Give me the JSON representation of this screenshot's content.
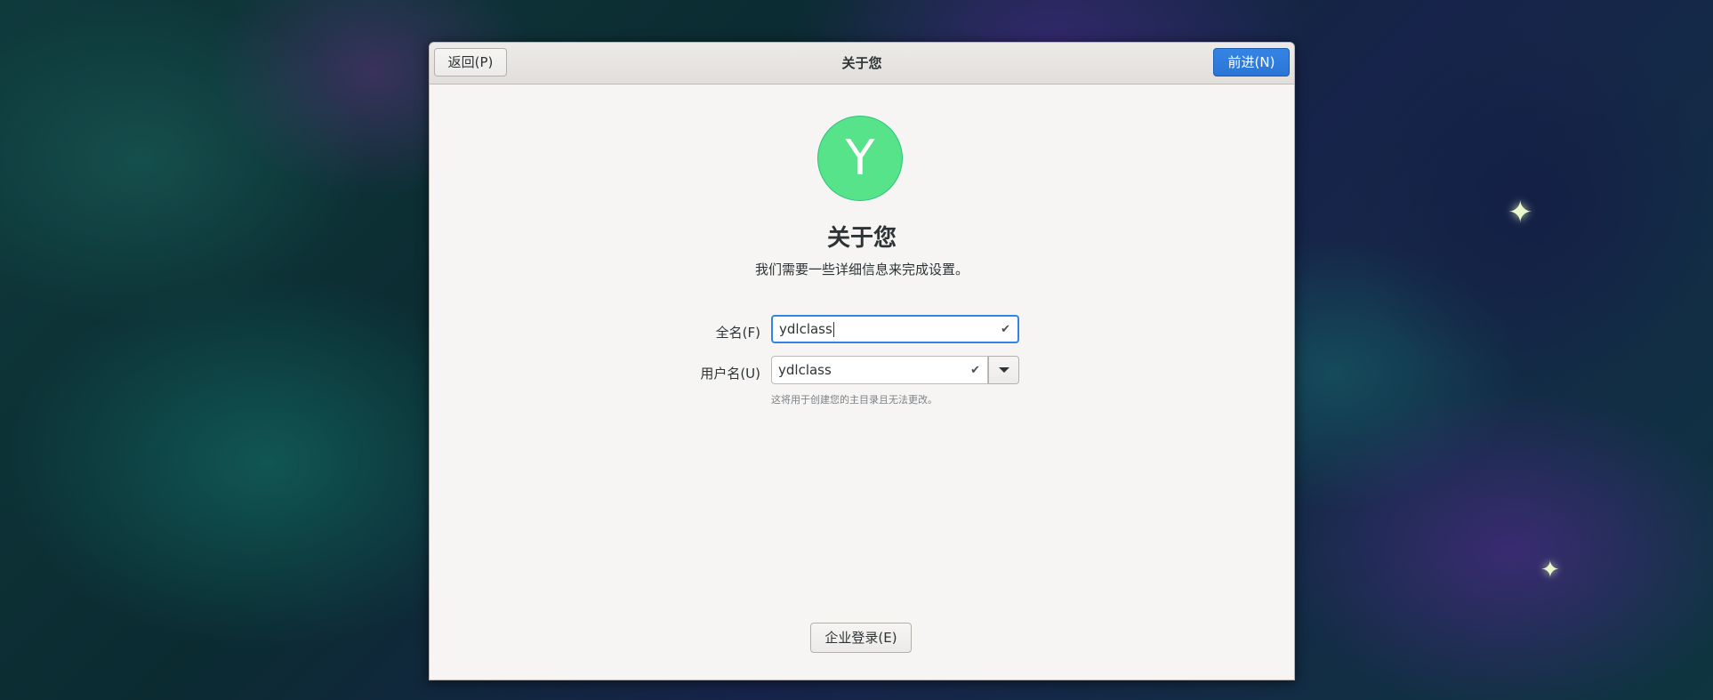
{
  "window": {
    "title": "关于您",
    "back_label": "返回(P)",
    "next_label": "前进(N)"
  },
  "avatar": {
    "letter": "Y",
    "color": "#57e389"
  },
  "page": {
    "heading": "关于您",
    "subtitle": "我们需要一些详细信息来完成设置。"
  },
  "form": {
    "fullname_label": "全名(F)",
    "fullname_value": "ydlclass",
    "username_label": "用户名(U)",
    "username_value": "ydlclass",
    "username_hint": "这将用于创建您的主目录且无法更改。",
    "check_icon": "✔"
  },
  "footer": {
    "enterprise_login_label": "企业登录(E)"
  },
  "colors": {
    "accent": "#3584e4",
    "avatar": "#57e389"
  }
}
